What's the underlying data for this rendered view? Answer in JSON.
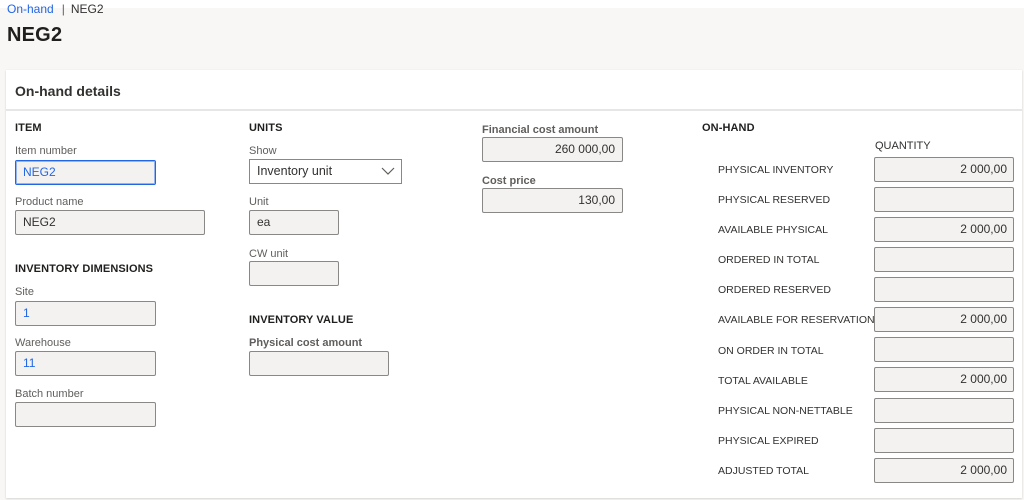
{
  "breadcrumb": {
    "parent": "On-hand",
    "separator": "|",
    "current": "NEG2"
  },
  "page_title": "NEG2",
  "card": {
    "title": "On-hand details"
  },
  "item": {
    "group_title": "ITEM",
    "item_number_label": "Item number",
    "item_number_value": "NEG2",
    "product_name_label": "Product name",
    "product_name_value": "NEG2"
  },
  "inventory_dimensions": {
    "group_title": "INVENTORY DIMENSIONS",
    "site_label": "Site",
    "site_value": "1",
    "warehouse_label": "Warehouse",
    "warehouse_value": "11",
    "batch_label": "Batch number",
    "batch_value": ""
  },
  "units": {
    "group_title": "UNITS",
    "show_label": "Show",
    "show_value": "Inventory unit",
    "unit_label": "Unit",
    "unit_value": "ea",
    "cw_unit_label": "CW unit",
    "cw_unit_value": ""
  },
  "inventory_value": {
    "group_title": "INVENTORY VALUE",
    "physical_cost_label": "Physical cost amount",
    "physical_cost_value": ""
  },
  "cost": {
    "financial_cost_label": "Financial cost amount",
    "financial_cost_value": "260 000,00",
    "cost_price_label": "Cost price",
    "cost_price_value": "130,00"
  },
  "on_hand": {
    "group_title": "ON-HAND",
    "column_header": "QUANTITY",
    "rows": [
      {
        "label": "PHYSICAL INVENTORY",
        "value": "2 000,00"
      },
      {
        "label": "PHYSICAL RESERVED",
        "value": ""
      },
      {
        "label": "AVAILABLE PHYSICAL",
        "value": "2 000,00"
      },
      {
        "label": "ORDERED IN TOTAL",
        "value": ""
      },
      {
        "label": "ORDERED RESERVED",
        "value": ""
      },
      {
        "label": "AVAILABLE FOR RESERVATION",
        "value": "2 000,00"
      },
      {
        "label": "ON ORDER IN TOTAL",
        "value": ""
      },
      {
        "label": "TOTAL AVAILABLE",
        "value": "2 000,00"
      },
      {
        "label": "PHYSICAL NON-NETTABLE",
        "value": ""
      },
      {
        "label": "PHYSICAL EXPIRED",
        "value": ""
      },
      {
        "label": "ADJUSTED TOTAL",
        "value": "2 000,00"
      }
    ]
  },
  "colors": {
    "link": "#2266e3",
    "page_background": "#f8f7f6",
    "field_background": "#f3f2f1",
    "field_border": "#8a8886"
  }
}
